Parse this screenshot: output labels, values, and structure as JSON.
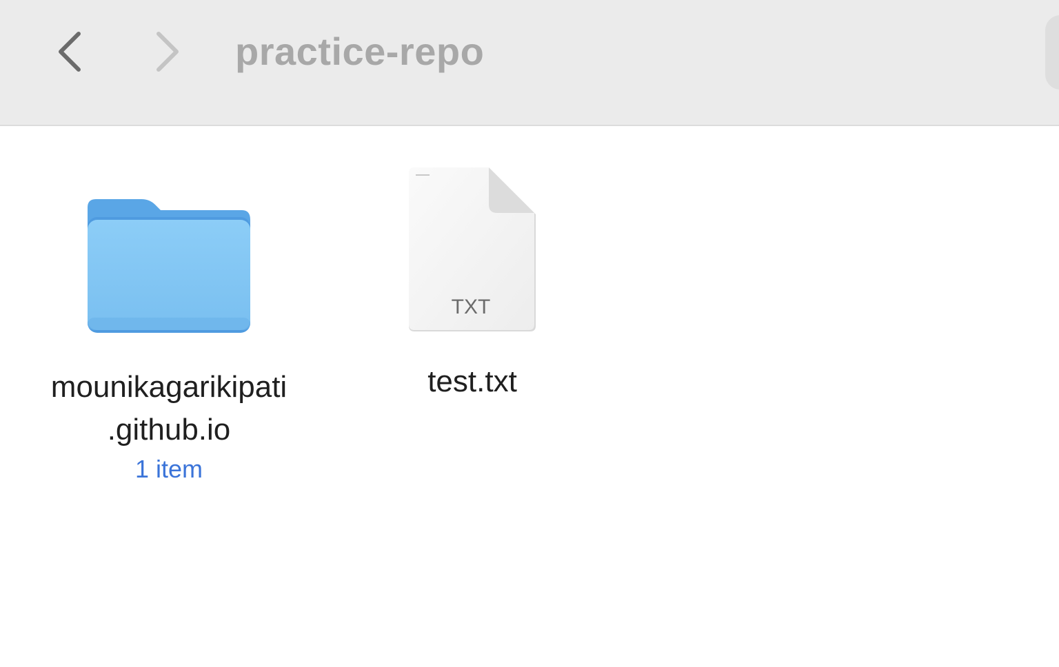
{
  "window": {
    "title": "practice-repo"
  },
  "toolbar": {
    "back_icon": "chevron-left-icon",
    "forward_icon": "chevron-right-icon"
  },
  "items": [
    {
      "kind": "folder",
      "icon": "folder-icon",
      "name_line1": "mounikagarikipati",
      "name_line2": ".github.io",
      "meta": "1 item"
    },
    {
      "kind": "file",
      "icon": "txt-file-icon",
      "badge": "TXT",
      "name": "test.txt"
    }
  ],
  "colors": {
    "toolbar_bg": "#ebebeb",
    "folder_blue": "#7cc2f2",
    "folder_tab": "#5aa6e6",
    "meta_blue": "#3b74d9"
  }
}
